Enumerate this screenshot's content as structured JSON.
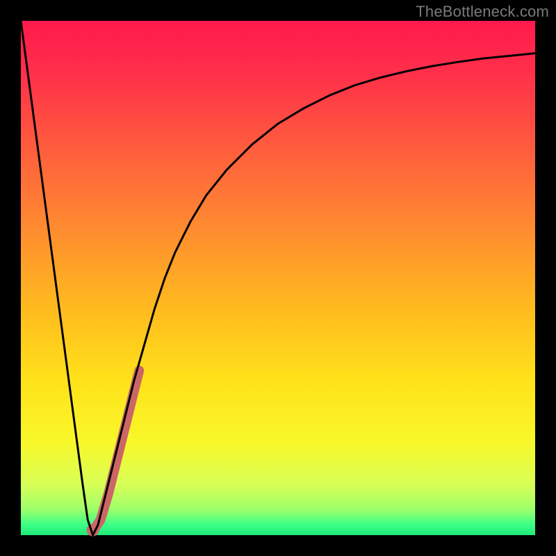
{
  "watermark": "TheBottleneck.com",
  "chart_data": {
    "type": "line",
    "title": "",
    "xlabel": "",
    "ylabel": "",
    "xlim": [
      0,
      100
    ],
    "ylim": [
      0,
      100
    ],
    "grid": false,
    "legend": false,
    "series": [
      {
        "name": "bottleneck-curve",
        "color": "#000000",
        "stroke_width": 3,
        "x": [
          0,
          2,
          4,
          6,
          8,
          10,
          12,
          13,
          14,
          15,
          16,
          18,
          20,
          22,
          24,
          26,
          28,
          30,
          33,
          36,
          40,
          45,
          50,
          55,
          60,
          65,
          70,
          75,
          80,
          85,
          90,
          95,
          100
        ],
        "y": [
          100,
          85,
          70,
          55,
          40,
          25,
          10,
          3,
          0,
          2,
          6,
          14,
          22,
          30,
          37,
          44,
          50,
          55,
          61,
          66,
          71,
          76,
          80,
          83,
          85.5,
          87.5,
          89,
          90.2,
          91.2,
          92,
          92.7,
          93.2,
          93.7
        ]
      },
      {
        "name": "highlight-segment",
        "color": "#cc6666",
        "stroke_width": 14,
        "linecap": "round",
        "x": [
          14.5,
          15.5,
          17,
          18.5,
          20,
          21.5,
          23
        ],
        "y": [
          1.5,
          3,
          8,
          14,
          20,
          26,
          32
        ]
      }
    ],
    "markers": [
      {
        "name": "min-marker",
        "x": 14,
        "y": 1,
        "r": 9,
        "color": "#cc6666"
      }
    ]
  }
}
